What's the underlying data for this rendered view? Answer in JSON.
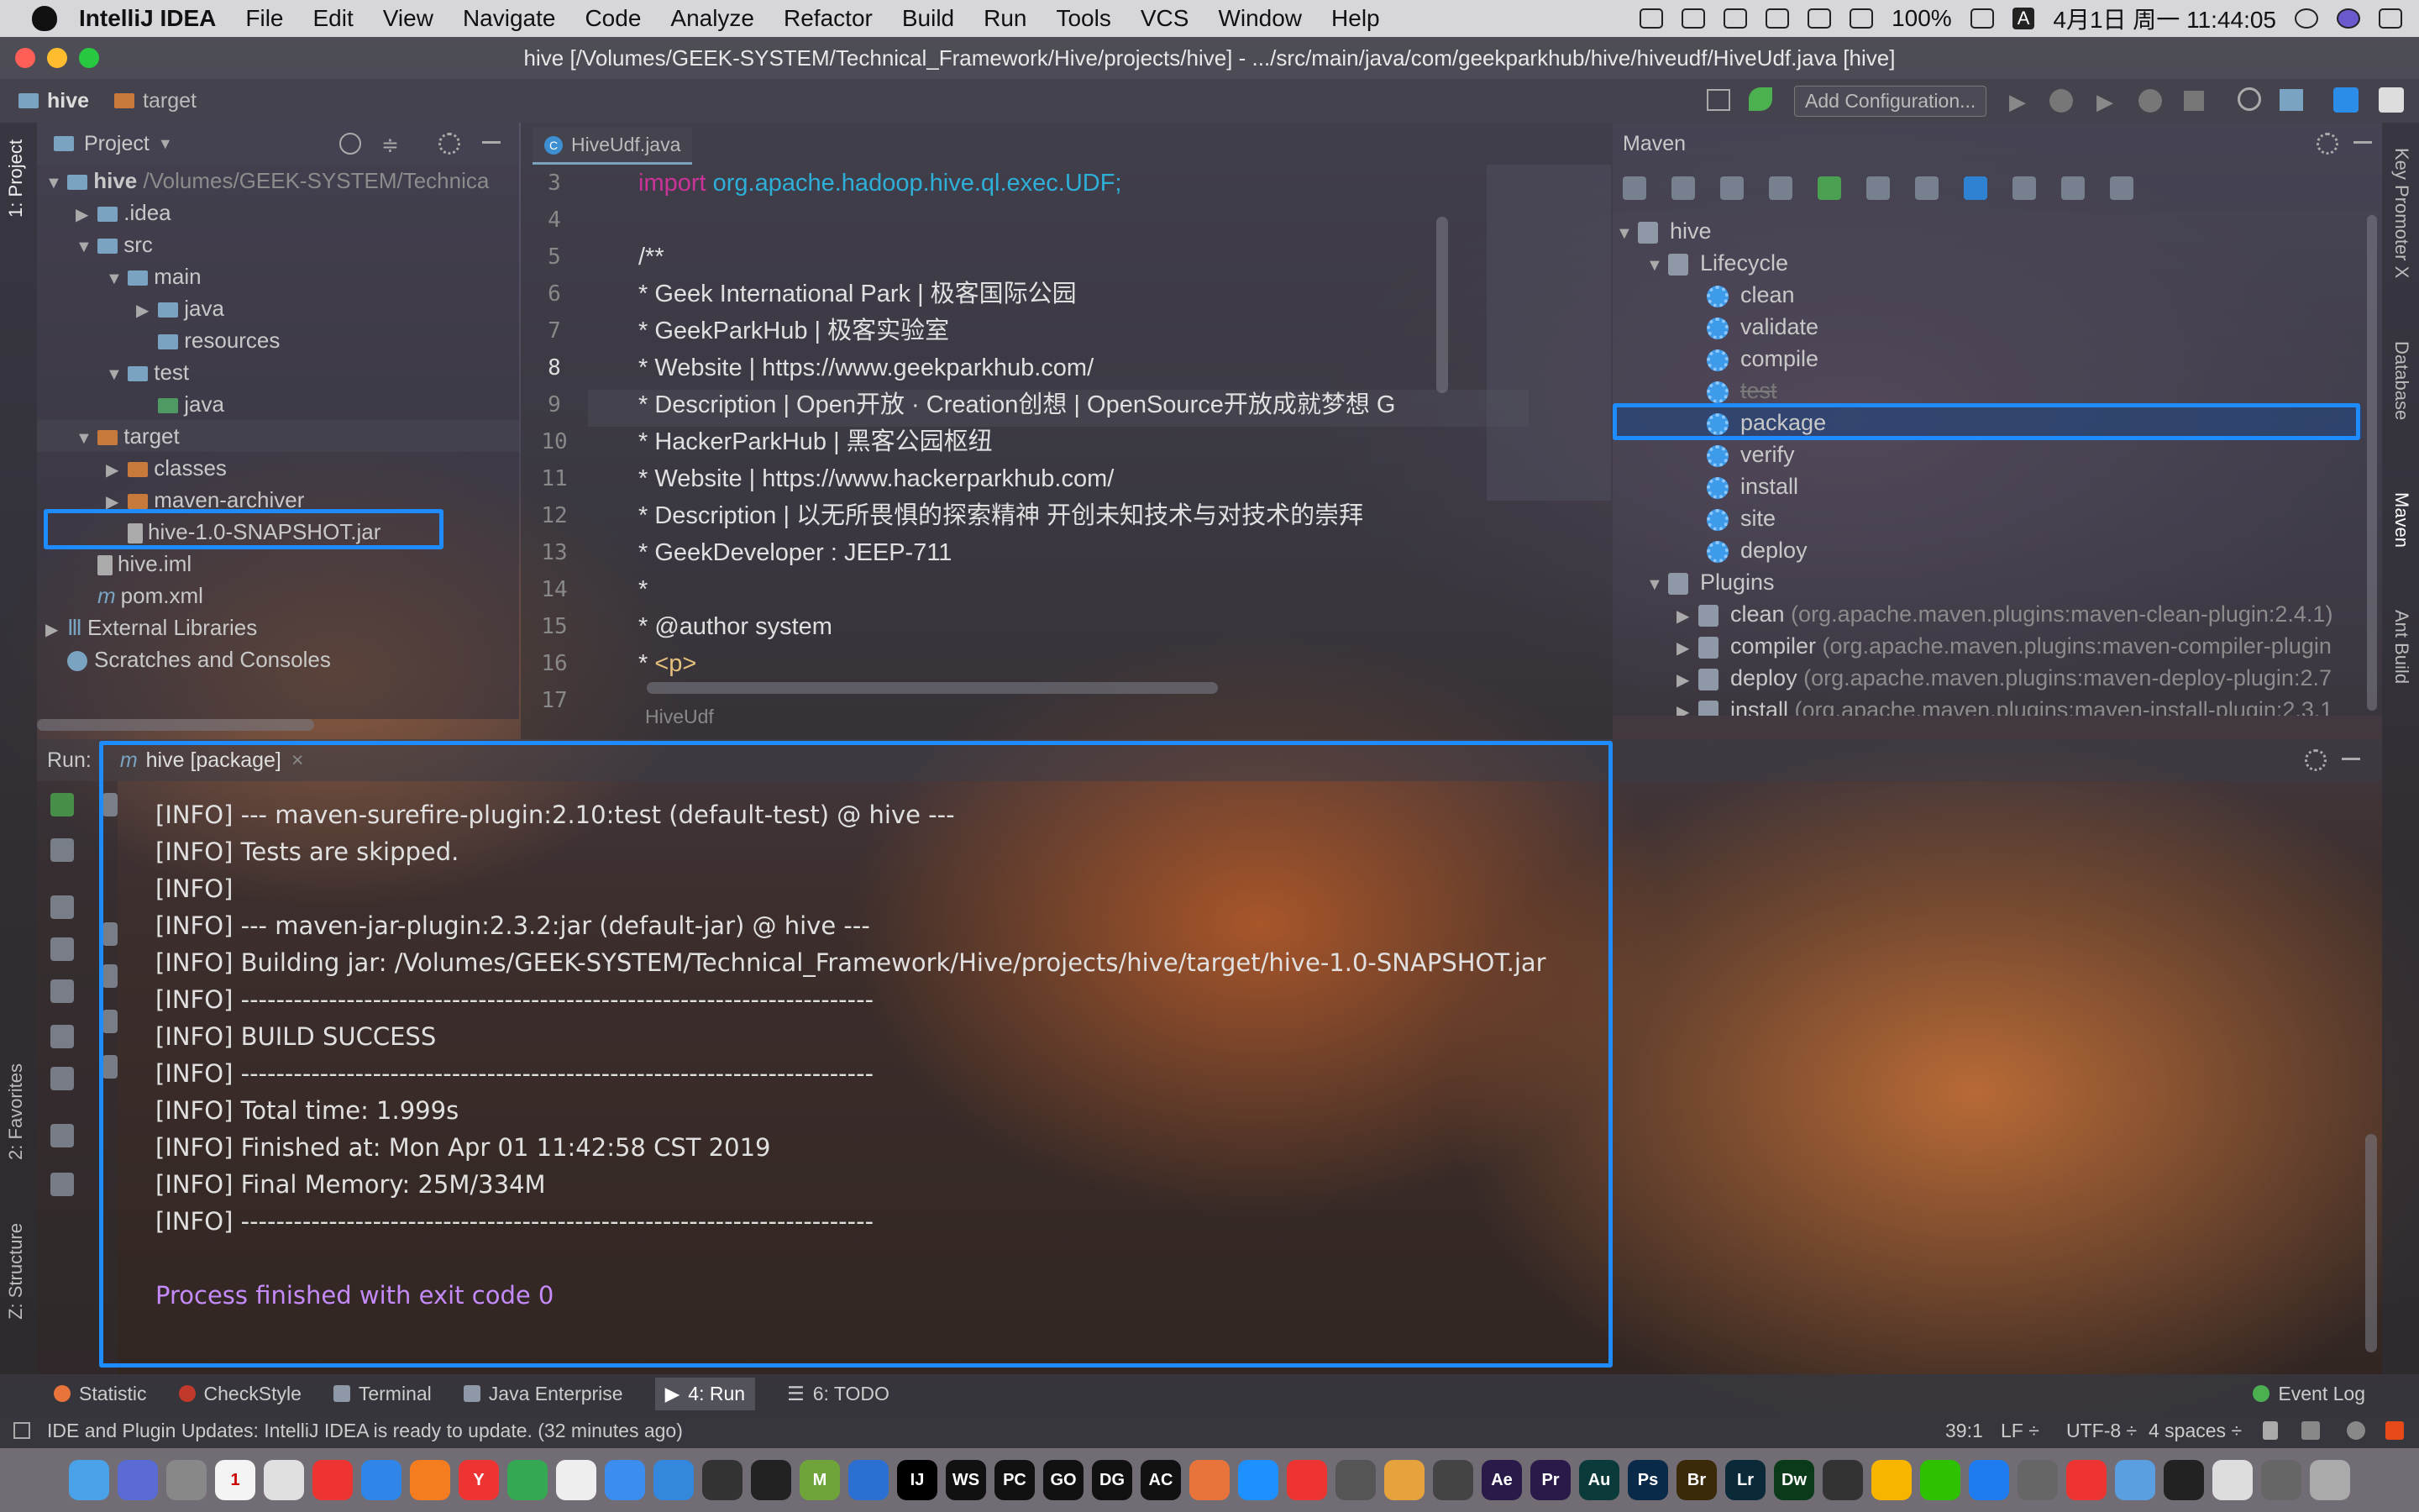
{
  "menubar": {
    "app": "IntelliJ IDEA",
    "items": [
      "File",
      "Edit",
      "View",
      "Navigate",
      "Code",
      "Analyze",
      "Refactor",
      "Build",
      "Run",
      "Tools",
      "VCS",
      "Window",
      "Help"
    ],
    "battery": "100%",
    "input_method": "A",
    "datetime": "4月1日 周一 11:44:05"
  },
  "window": {
    "title": "hive [/Volumes/GEEK-SYSTEM/Technical_Framework/Hive/projects/hive] - .../src/main/java/com/geekparkhub/hive/hiveudf/HiveUdf.java [hive]"
  },
  "navbar": {
    "crumb1": "hive",
    "crumb2": "target",
    "add_config": "Add Configuration..."
  },
  "left_strip": {
    "project_tab": "1: Project",
    "favorites_tab": "2: Favorites",
    "structure_tab": "Z: Structure"
  },
  "right_strip": {
    "keypromoter": "Key Promoter X",
    "database": "Database",
    "maven": "Maven",
    "ant": "Ant Build"
  },
  "project": {
    "title": "Project",
    "tree": [
      {
        "label": "hive",
        "extra": "/Volumes/GEEK-SYSTEM/Technica",
        "kind": "folder",
        "bold": true
      },
      {
        "label": ".idea",
        "kind": "folder"
      },
      {
        "label": "src",
        "kind": "folder"
      },
      {
        "label": "main",
        "kind": "folder"
      },
      {
        "label": "java",
        "kind": "folder"
      },
      {
        "label": "resources",
        "kind": "folder"
      },
      {
        "label": "test",
        "kind": "folder"
      },
      {
        "label": "java",
        "kind": "folder"
      },
      {
        "label": "target",
        "kind": "folder-orange"
      },
      {
        "label": "classes",
        "kind": "folder-orange"
      },
      {
        "label": "maven-archiver",
        "kind": "folder-orange"
      },
      {
        "label": "hive-1.0-SNAPSHOT.jar",
        "kind": "file"
      },
      {
        "label": "hive.iml",
        "kind": "file"
      },
      {
        "label": "pom.xml",
        "kind": "file"
      },
      {
        "label": "External Libraries",
        "kind": "lib"
      },
      {
        "label": "Scratches and Consoles",
        "kind": "scratch"
      }
    ]
  },
  "editor": {
    "tab": "HiveUdf.java",
    "breadcrumb": "HiveUdf",
    "gutter": [
      "3",
      "4",
      "5",
      "6",
      "7",
      "8",
      "9",
      "10",
      "11",
      "12",
      "13",
      "14",
      "15",
      "16",
      "17"
    ],
    "lines": [
      {
        "k": "import",
        "rest": " org.apache.hadoop.hive.ql.exec.UDF;"
      },
      {
        "t": ""
      },
      {
        "t": "/**"
      },
      {
        "t": " * Geek International Park | 极客国际公园"
      },
      {
        "t": " * GeekParkHub | 极客实验室"
      },
      {
        "t": " * Website | https://www.geekparkhub.com/"
      },
      {
        "t": " * Description | Open开放 · Creation创想 | OpenSource开放成就梦想 G"
      },
      {
        "t": " * HackerParkHub | 黑客公园枢纽"
      },
      {
        "t": " * Website | https://www.hackerparkhub.com/"
      },
      {
        "t": " * Description | 以无所畏惧的探索精神 开创未知技术与对技术的崇拜"
      },
      {
        "t": " * GeekDeveloper : JEEP-711"
      },
      {
        "t": " *"
      },
      {
        "t": " * @author system"
      },
      {
        "t": " * ",
        "tag": "<p>"
      },
      {
        "t": ""
      }
    ]
  },
  "maven": {
    "title": "Maven",
    "root": "hive",
    "lifecycle": "Lifecycle",
    "goals": [
      "clean",
      "validate",
      "compile",
      "test",
      "package",
      "verify",
      "install",
      "site",
      "deploy"
    ],
    "plugins_label": "Plugins",
    "plugins": [
      {
        "name": "clean",
        "coord": "(org.apache.maven.plugins:maven-clean-plugin:2.4.1)"
      },
      {
        "name": "compiler",
        "coord": "(org.apache.maven.plugins:maven-compiler-plugin"
      },
      {
        "name": "deploy",
        "coord": "(org.apache.maven.plugins:maven-deploy-plugin:2.7"
      },
      {
        "name": "install",
        "coord": "(org.apache.maven.plugins:maven-install-plugin:2.3.1"
      }
    ]
  },
  "run": {
    "label": "Run:",
    "tab": "hive [package]",
    "close": "×",
    "lines": [
      "[INFO] --- maven-surefire-plugin:2.10:test (default-test) @ hive ---",
      "[INFO] Tests are skipped.",
      "[INFO]",
      "[INFO] --- maven-jar-plugin:2.3.2:jar (default-jar) @ hive ---",
      "[INFO] Building jar: /Volumes/GEEK-SYSTEM/Technical_Framework/Hive/projects/hive/target/hive-1.0-SNAPSHOT.jar",
      "[INFO] ------------------------------------------------------------------------",
      "[INFO] BUILD SUCCESS",
      "[INFO] ------------------------------------------------------------------------",
      "[INFO] Total time: 1.999s",
      "[INFO] Finished at: Mon Apr 01 11:42:58 CST 2019",
      "[INFO] Final Memory: 25M/334M",
      "[INFO] ------------------------------------------------------------------------"
    ],
    "exit": "Process finished with exit code 0"
  },
  "bottom_tabs": [
    "Statistic",
    "CheckStyle",
    "Terminal",
    "Java Enterprise",
    "4: Run",
    "6: TODO"
  ],
  "event_log": "Event Log",
  "status": {
    "message": "IDE and Plugin Updates: IntelliJ IDEA is ready to update. (32 minutes ago)",
    "position": "39:1",
    "line_sep": "LF ÷",
    "encoding": "UTF-8 ÷",
    "indent": "4 spaces ÷"
  },
  "dock": [
    {
      "label": "",
      "color": "#4aa3e8"
    },
    {
      "label": "",
      "color": "#5b6bd6"
    },
    {
      "label": "",
      "color": "#888"
    },
    {
      "label": "1",
      "color": "#f4f4f4"
    },
    {
      "label": "",
      "color": "#e0e0e0"
    },
    {
      "label": "",
      "color": "#e33"
    },
    {
      "label": "",
      "color": "#2f86e8"
    },
    {
      "label": "",
      "color": "#f57c1f"
    },
    {
      "label": "Y",
      "color": "#e33"
    },
    {
      "label": "",
      "color": "#34a853"
    },
    {
      "label": "",
      "color": "#eee"
    },
    {
      "label": "",
      "color": "#3b8df0"
    },
    {
      "label": "",
      "color": "#3388dd"
    },
    {
      "label": "",
      "color": "#333"
    },
    {
      "label": "",
      "color": "#222"
    },
    {
      "label": "M",
      "color": "#6ea43a"
    },
    {
      "label": "",
      "color": "#2a6fd1"
    },
    {
      "label": "IJ",
      "color": "#000"
    },
    {
      "label": "WS",
      "color": "#111"
    },
    {
      "label": "PC",
      "color": "#111"
    },
    {
      "label": "GO",
      "color": "#111"
    },
    {
      "label": "DG",
      "color": "#111"
    },
    {
      "label": "AC",
      "color": "#111"
    },
    {
      "label": "",
      "color": "#e8743b"
    },
    {
      "label": "",
      "color": "#1e90ff"
    },
    {
      "label": "",
      "color": "#e33"
    },
    {
      "label": "",
      "color": "#555"
    },
    {
      "label": "",
      "color": "#e6a23c"
    },
    {
      "label": "",
      "color": "#444"
    },
    {
      "label": "Ae",
      "color": "#2a1a4a"
    },
    {
      "label": "Pr",
      "color": "#2a1a4a"
    },
    {
      "label": "Au",
      "color": "#0a3a3a"
    },
    {
      "label": "Ps",
      "color": "#0a2a4a"
    },
    {
      "label": "Br",
      "color": "#3a2a0a"
    },
    {
      "label": "Lr",
      "color": "#0a2a3a"
    },
    {
      "label": "Dw",
      "color": "#0a3a1a"
    },
    {
      "label": "",
      "color": "#333"
    },
    {
      "label": "",
      "color": "#f7b500"
    },
    {
      "label": "",
      "color": "#2dc100"
    },
    {
      "label": "",
      "color": "#1e7cf0"
    },
    {
      "label": "",
      "color": "#666"
    },
    {
      "label": "",
      "color": "#e33"
    },
    {
      "label": "",
      "color": "#5aa0e0"
    },
    {
      "label": "",
      "color": "#222"
    },
    {
      "label": "",
      "color": "#ddd"
    },
    {
      "label": "",
      "color": "#666"
    },
    {
      "label": "",
      "color": "#aaa"
    }
  ]
}
